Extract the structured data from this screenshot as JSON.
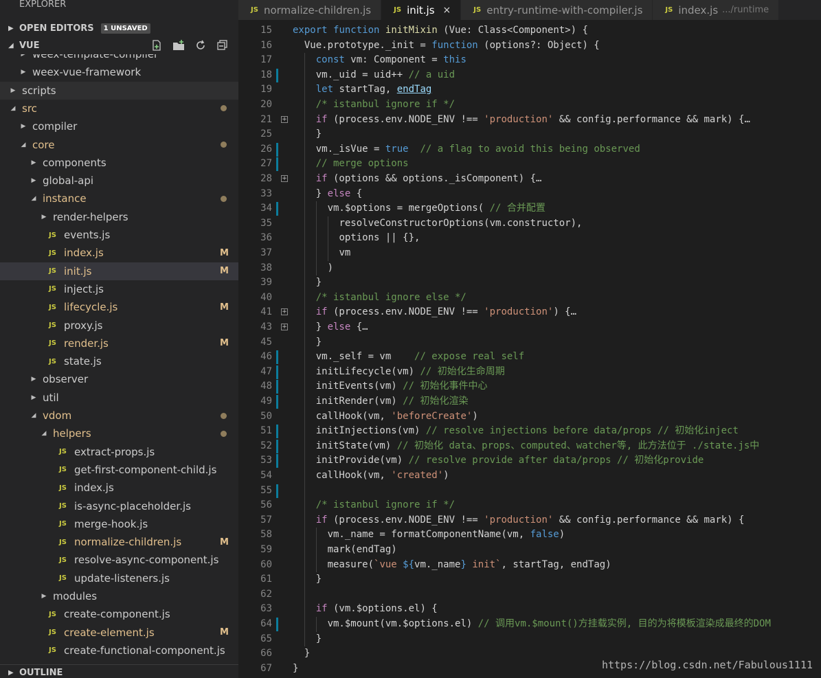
{
  "explorer": {
    "title": "EXPLORER",
    "open_editors": {
      "label": "OPEN EDITORS",
      "badge": "1 UNSAVED"
    },
    "project": {
      "label": "VUE"
    },
    "header_actions": [
      {
        "name": "new-file-icon"
      },
      {
        "name": "new-folder-icon"
      },
      {
        "name": "refresh-icon"
      },
      {
        "name": "collapse-all-icon"
      }
    ],
    "tree": [
      {
        "label": "weex-template-compiler",
        "kind": "folder",
        "depth": 2,
        "expanded": false,
        "status": "",
        "partial": true
      },
      {
        "label": "weex-vue-framework",
        "kind": "folder",
        "depth": 2,
        "expanded": false,
        "status": ""
      },
      {
        "label": "scripts",
        "kind": "folder",
        "depth": 1,
        "expanded": false,
        "status": "",
        "hl": true
      },
      {
        "label": "src",
        "kind": "folder",
        "depth": 1,
        "expanded": true,
        "status": "dot",
        "mod": true
      },
      {
        "label": "compiler",
        "kind": "folder",
        "depth": 2,
        "expanded": false,
        "status": ""
      },
      {
        "label": "core",
        "kind": "folder",
        "depth": 2,
        "expanded": true,
        "status": "dot",
        "mod": true
      },
      {
        "label": "components",
        "kind": "folder",
        "depth": 3,
        "expanded": false,
        "status": ""
      },
      {
        "label": "global-api",
        "kind": "folder",
        "depth": 3,
        "expanded": false,
        "status": ""
      },
      {
        "label": "instance",
        "kind": "folder",
        "depth": 3,
        "expanded": true,
        "status": "dot",
        "mod": true
      },
      {
        "label": "render-helpers",
        "kind": "folder",
        "depth": 4,
        "expanded": false,
        "status": ""
      },
      {
        "label": "events.js",
        "kind": "js",
        "depth": 4,
        "status": ""
      },
      {
        "label": "index.js",
        "kind": "js",
        "depth": 4,
        "status": "M",
        "mod": true
      },
      {
        "label": "init.js",
        "kind": "js",
        "depth": 4,
        "status": "M",
        "mod": true,
        "selected": true
      },
      {
        "label": "inject.js",
        "kind": "js",
        "depth": 4,
        "status": ""
      },
      {
        "label": "lifecycle.js",
        "kind": "js",
        "depth": 4,
        "status": "M",
        "mod": true
      },
      {
        "label": "proxy.js",
        "kind": "js",
        "depth": 4,
        "status": ""
      },
      {
        "label": "render.js",
        "kind": "js",
        "depth": 4,
        "status": "M",
        "mod": true
      },
      {
        "label": "state.js",
        "kind": "js",
        "depth": 4,
        "status": ""
      },
      {
        "label": "observer",
        "kind": "folder",
        "depth": 3,
        "expanded": false,
        "status": ""
      },
      {
        "label": "util",
        "kind": "folder",
        "depth": 3,
        "expanded": false,
        "status": ""
      },
      {
        "label": "vdom",
        "kind": "folder",
        "depth": 3,
        "expanded": true,
        "status": "dot",
        "mod": true
      },
      {
        "label": "helpers",
        "kind": "folder",
        "depth": 4,
        "expanded": true,
        "status": "dot",
        "mod": true
      },
      {
        "label": "extract-props.js",
        "kind": "js",
        "depth": 5,
        "status": ""
      },
      {
        "label": "get-first-component-child.js",
        "kind": "js",
        "depth": 5,
        "status": ""
      },
      {
        "label": "index.js",
        "kind": "js",
        "depth": 5,
        "status": ""
      },
      {
        "label": "is-async-placeholder.js",
        "kind": "js",
        "depth": 5,
        "status": ""
      },
      {
        "label": "merge-hook.js",
        "kind": "js",
        "depth": 5,
        "status": ""
      },
      {
        "label": "normalize-children.js",
        "kind": "js",
        "depth": 5,
        "status": "M",
        "mod": true
      },
      {
        "label": "resolve-async-component.js",
        "kind": "js",
        "depth": 5,
        "status": ""
      },
      {
        "label": "update-listeners.js",
        "kind": "js",
        "depth": 5,
        "status": ""
      },
      {
        "label": "modules",
        "kind": "folder",
        "depth": 4,
        "expanded": false,
        "status": ""
      },
      {
        "label": "create-component.js",
        "kind": "js",
        "depth": 4,
        "status": ""
      },
      {
        "label": "create-element.js",
        "kind": "js",
        "depth": 4,
        "status": "M",
        "mod": true
      },
      {
        "label": "create-functional-component.js",
        "kind": "js",
        "depth": 4,
        "status": ""
      }
    ],
    "outline": {
      "label": "OUTLINE"
    }
  },
  "tabs": [
    {
      "label": "normalize-children.js",
      "desc": "",
      "active": false,
      "icon": "JS"
    },
    {
      "label": "init.js",
      "desc": "",
      "active": true,
      "icon": "JS",
      "close": "×"
    },
    {
      "label": "entry-runtime-with-compiler.js",
      "desc": "",
      "active": false,
      "icon": "JS"
    },
    {
      "label": "index.js",
      "desc": ".../runtime",
      "active": false,
      "icon": "JS"
    }
  ],
  "colors": {
    "keyword": "#569cd6",
    "control": "#c586c0",
    "string": "#ce9178",
    "comment": "#6a9955",
    "type": "#4ec9b0",
    "function": "#dcdcaa",
    "variable": "#9cdcfe",
    "modified": "#e2c08d",
    "gutter_bar": "#0c7d9d"
  },
  "editor": {
    "lines": [
      {
        "n": "15",
        "indent": 0,
        "tokens": [
          [
            "kw",
            "export"
          ],
          [
            "p",
            " "
          ],
          [
            "kw",
            "function"
          ],
          [
            "p",
            " "
          ],
          [
            "fn",
            "initMixin"
          ],
          [
            "p",
            " (Vue: Class<Component>) {"
          ]
        ]
      },
      {
        "n": "16",
        "indent": 1,
        "tokens": [
          [
            "p",
            "Vue.prototype._init = "
          ],
          [
            "kw",
            "function"
          ],
          [
            "p",
            " (options?: Object) {"
          ]
        ]
      },
      {
        "n": "17",
        "indent": 2,
        "tokens": [
          [
            "kw",
            "const"
          ],
          [
            "p",
            " vm: Component = "
          ],
          [
            "kw",
            "this"
          ]
        ]
      },
      {
        "n": "18",
        "indent": 2,
        "bar": true,
        "tokens": [
          [
            "p",
            "vm._uid = uid++ "
          ],
          [
            "com",
            "// a uid"
          ]
        ]
      },
      {
        "n": "19",
        "indent": 2,
        "tokens": [
          [
            "kw",
            "let"
          ],
          [
            "p",
            " startTag, "
          ],
          [
            "link",
            "endTag"
          ]
        ]
      },
      {
        "n": "20",
        "indent": 2,
        "tokens": [
          [
            "com",
            "/* istanbul ignore if */"
          ]
        ]
      },
      {
        "n": "21",
        "indent": 2,
        "fold": true,
        "tokens": [
          [
            "ctl",
            "if"
          ],
          [
            "p",
            " (process.env.NODE_ENV !== "
          ],
          [
            "str",
            "'production'"
          ],
          [
            "p",
            " && config.performance && mark) {…"
          ]
        ]
      },
      {
        "n": "25",
        "indent": 2,
        "tokens": [
          [
            "p",
            "}"
          ]
        ]
      },
      {
        "n": "26",
        "indent": 2,
        "bar": true,
        "tokens": [
          [
            "p",
            "vm._isVue = "
          ],
          [
            "kw",
            "true"
          ],
          [
            "p",
            "  "
          ],
          [
            "com",
            "// a flag to avoid this being observed"
          ]
        ]
      },
      {
        "n": "27",
        "indent": 2,
        "bar": true,
        "tokens": [
          [
            "com",
            "// merge options"
          ]
        ]
      },
      {
        "n": "28",
        "indent": 2,
        "fold": true,
        "tokens": [
          [
            "ctl",
            "if"
          ],
          [
            "p",
            " (options && options._isComponent) {…"
          ]
        ]
      },
      {
        "n": "33",
        "indent": 2,
        "tokens": [
          [
            "p",
            "} "
          ],
          [
            "ctl",
            "else"
          ],
          [
            "p",
            " {"
          ]
        ]
      },
      {
        "n": "34",
        "indent": 3,
        "bar": true,
        "tokens": [
          [
            "p",
            "vm.$options = mergeOptions( "
          ],
          [
            "com",
            "// 合并配置"
          ]
        ]
      },
      {
        "n": "35",
        "indent": 4,
        "tokens": [
          [
            "p",
            "resolveConstructorOptions(vm.constructor),"
          ]
        ]
      },
      {
        "n": "36",
        "indent": 4,
        "tokens": [
          [
            "p",
            "options || {},"
          ]
        ]
      },
      {
        "n": "37",
        "indent": 4,
        "tokens": [
          [
            "p",
            "vm"
          ]
        ]
      },
      {
        "n": "38",
        "indent": 3,
        "tokens": [
          [
            "p",
            ")"
          ]
        ]
      },
      {
        "n": "39",
        "indent": 2,
        "tokens": [
          [
            "p",
            "}"
          ]
        ]
      },
      {
        "n": "40",
        "indent": 2,
        "tokens": [
          [
            "com",
            "/* istanbul ignore else */"
          ]
        ]
      },
      {
        "n": "41",
        "indent": 2,
        "fold": true,
        "tokens": [
          [
            "ctl",
            "if"
          ],
          [
            "p",
            " (process.env.NODE_ENV !== "
          ],
          [
            "str",
            "'production'"
          ],
          [
            "p",
            ") {…"
          ]
        ]
      },
      {
        "n": "43",
        "indent": 2,
        "fold": true,
        "tokens": [
          [
            "p",
            "} "
          ],
          [
            "ctl",
            "else"
          ],
          [
            "p",
            " {…"
          ]
        ]
      },
      {
        "n": "45",
        "indent": 2,
        "tokens": [
          [
            "p",
            "}"
          ]
        ]
      },
      {
        "n": "46",
        "indent": 2,
        "bar": true,
        "tokens": [
          [
            "p",
            "vm._self = vm    "
          ],
          [
            "com",
            "// expose real self"
          ]
        ]
      },
      {
        "n": "47",
        "indent": 2,
        "bar": true,
        "tokens": [
          [
            "p",
            "initLifecycle(vm) "
          ],
          [
            "com",
            "// 初始化生命周期"
          ]
        ]
      },
      {
        "n": "48",
        "indent": 2,
        "bar": true,
        "tokens": [
          [
            "p",
            "initEvents(vm) "
          ],
          [
            "com",
            "// 初始化事件中心"
          ]
        ]
      },
      {
        "n": "49",
        "indent": 2,
        "bar": true,
        "tokens": [
          [
            "p",
            "initRender(vm) "
          ],
          [
            "com",
            "// 初始化渲染"
          ]
        ]
      },
      {
        "n": "50",
        "indent": 2,
        "tokens": [
          [
            "p",
            "callHook(vm, "
          ],
          [
            "str",
            "'beforeCreate'"
          ],
          [
            "p",
            ")"
          ]
        ]
      },
      {
        "n": "51",
        "indent": 2,
        "bar": true,
        "tokens": [
          [
            "p",
            "initInjections(vm) "
          ],
          [
            "com",
            "// resolve injections before data/props // 初始化inject"
          ]
        ]
      },
      {
        "n": "52",
        "indent": 2,
        "bar": true,
        "tokens": [
          [
            "p",
            "initState(vm) "
          ],
          [
            "com",
            "// 初始化 data、props、computed、watcher等, 此方法位于 ./state.js中"
          ]
        ]
      },
      {
        "n": "53",
        "indent": 2,
        "bar": true,
        "tokens": [
          [
            "p",
            "initProvide(vm) "
          ],
          [
            "com",
            "// resolve provide after data/props // 初始化provide"
          ]
        ]
      },
      {
        "n": "54",
        "indent": 2,
        "tokens": [
          [
            "p",
            "callHook(vm, "
          ],
          [
            "str",
            "'created'"
          ],
          [
            "p",
            ")"
          ]
        ]
      },
      {
        "n": "55",
        "indent": 2,
        "bar": true,
        "tokens": []
      },
      {
        "n": "56",
        "indent": 2,
        "tokens": [
          [
            "com",
            "/* istanbul ignore if */"
          ]
        ]
      },
      {
        "n": "57",
        "indent": 2,
        "tokens": [
          [
            "ctl",
            "if"
          ],
          [
            "p",
            " (process.env.NODE_ENV !== "
          ],
          [
            "str",
            "'production'"
          ],
          [
            "p",
            " && config.performance && mark) {"
          ]
        ]
      },
      {
        "n": "58",
        "indent": 3,
        "tokens": [
          [
            "p",
            "vm._name = formatComponentName(vm, "
          ],
          [
            "kw",
            "false"
          ],
          [
            "p",
            ")"
          ]
        ]
      },
      {
        "n": "59",
        "indent": 3,
        "tokens": [
          [
            "p",
            "mark(endTag)"
          ]
        ]
      },
      {
        "n": "60",
        "indent": 3,
        "tokens": [
          [
            "p",
            "measure("
          ],
          [
            "str",
            "`vue "
          ],
          [
            "kw",
            "${"
          ],
          [
            "p",
            "vm._name"
          ],
          [
            "kw",
            "}"
          ],
          [
            "str",
            " init`"
          ],
          [
            "p",
            ", startTag, endTag)"
          ]
        ]
      },
      {
        "n": "61",
        "indent": 2,
        "tokens": [
          [
            "p",
            "}"
          ]
        ]
      },
      {
        "n": "62",
        "indent": 2,
        "tokens": []
      },
      {
        "n": "63",
        "indent": 2,
        "tokens": [
          [
            "ctl",
            "if"
          ],
          [
            "p",
            " (vm.$options.el) {"
          ]
        ]
      },
      {
        "n": "64",
        "indent": 3,
        "bar": true,
        "tokens": [
          [
            "p",
            "vm.$mount(vm.$options.el) "
          ],
          [
            "com",
            "// 调用vm.$mount()方挂载实例, 目的为将模板渲染成最终的DOM"
          ]
        ]
      },
      {
        "n": "65",
        "indent": 2,
        "tokens": [
          [
            "p",
            "}"
          ]
        ]
      },
      {
        "n": "66",
        "indent": 1,
        "tokens": [
          [
            "p",
            "}"
          ]
        ]
      },
      {
        "n": "67",
        "indent": 0,
        "tokens": [
          [
            "p",
            "}"
          ]
        ]
      }
    ]
  },
  "watermark": "https://blog.csdn.net/Fabulous1111"
}
